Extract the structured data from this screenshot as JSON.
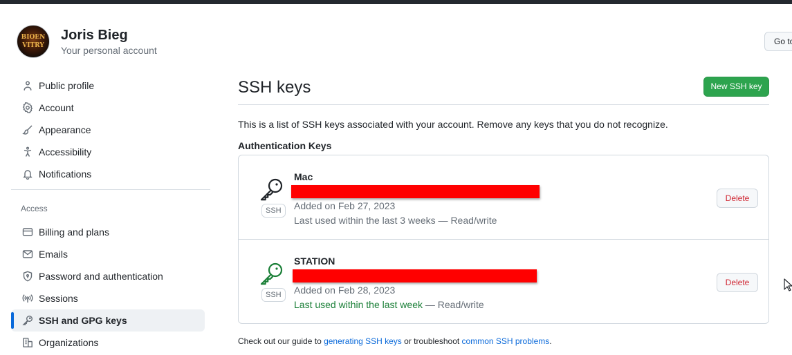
{
  "user": {
    "name": "Joris Bieg",
    "subtitle": "Your personal account",
    "avatar_text_line1": "BIOEN",
    "avatar_text_line2": "VITRY"
  },
  "goto_button": "Go to",
  "sidebar": {
    "items_top": [
      {
        "label": "Public profile",
        "icon": "person-icon"
      },
      {
        "label": "Account",
        "icon": "gear-icon"
      },
      {
        "label": "Appearance",
        "icon": "paintbrush-icon"
      },
      {
        "label": "Accessibility",
        "icon": "accessibility-icon"
      },
      {
        "label": "Notifications",
        "icon": "bell-icon"
      }
    ],
    "access_heading": "Access",
    "items_access": [
      {
        "label": "Billing and plans",
        "icon": "credit-card-icon"
      },
      {
        "label": "Emails",
        "icon": "mail-icon"
      },
      {
        "label": "Password and authentication",
        "icon": "shield-lock-icon"
      },
      {
        "label": "Sessions",
        "icon": "broadcast-icon"
      },
      {
        "label": "SSH and GPG keys",
        "icon": "key-icon",
        "active": true
      },
      {
        "label": "Organizations",
        "icon": "organization-icon"
      }
    ]
  },
  "main": {
    "title": "SSH keys",
    "new_button": "New SSH key",
    "intro": "This is a list of SSH keys associated with your account. Remove any keys that you do not recognize.",
    "section_heading": "Authentication Keys",
    "keys": [
      {
        "title": "Mac",
        "ssh_label": "SSH",
        "added": "Added on Feb 27, 2023",
        "last_used": "Last used within the last 3 weeks",
        "last_used_suffix": " — Read/write",
        "delete_label": "Delete",
        "icon_color": "#1f2328"
      },
      {
        "title": "STATION",
        "ssh_label": "SSH",
        "added": "Added on Feb 28, 2023",
        "last_used": "Last used within the last week",
        "last_used_suffix": " — Read/write",
        "delete_label": "Delete",
        "icon_color": "#1a7f37"
      }
    ],
    "footer": {
      "prefix": "Check out our guide to ",
      "link1": "generating SSH keys",
      "middle": " or troubleshoot ",
      "link2": "common SSH problems",
      "suffix": "."
    }
  },
  "colors": {
    "accent": "#0969da",
    "primary_button": "#2da44e",
    "danger": "#cf222e",
    "recent_green": "#1a7f37",
    "redaction": "#ff0000"
  }
}
